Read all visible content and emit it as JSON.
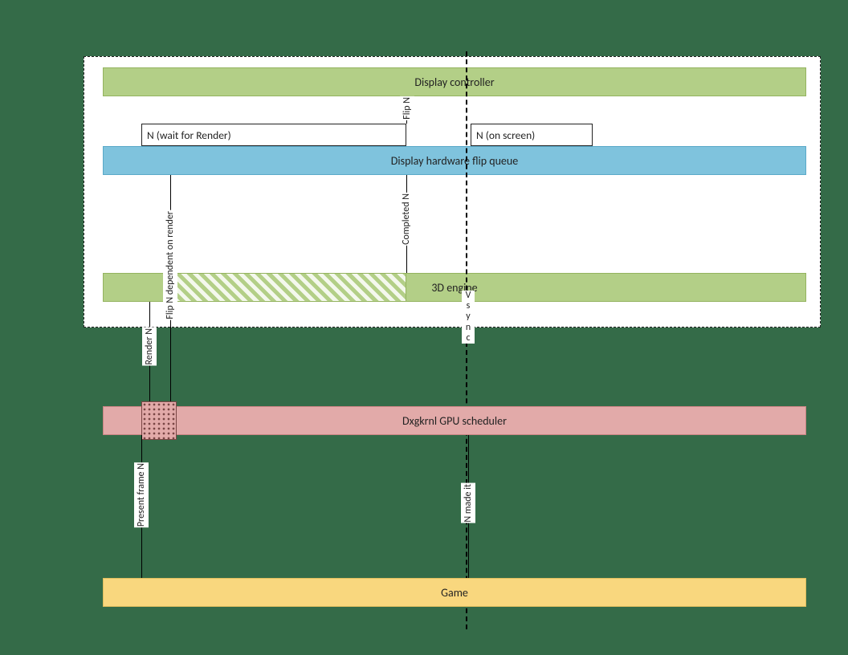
{
  "lanes": {
    "display_controller": "Display controller",
    "flip_queue": "Display hardware flip queue",
    "engine_3d": "3D engine",
    "scheduler": "Dxgkrnl GPU scheduler",
    "game": "Game"
  },
  "boxes": {
    "wait_render": "N (wait for Render)",
    "on_screen": "N (on screen)"
  },
  "labels": {
    "flip_n": "Flip N",
    "completed_n": "Completed N",
    "flip_n_dep": "Flip N dependent on render",
    "render_n": "Render N",
    "present_frame_n": "Present frame N",
    "n_made_it": "N made it",
    "vsync": "Vsync"
  }
}
